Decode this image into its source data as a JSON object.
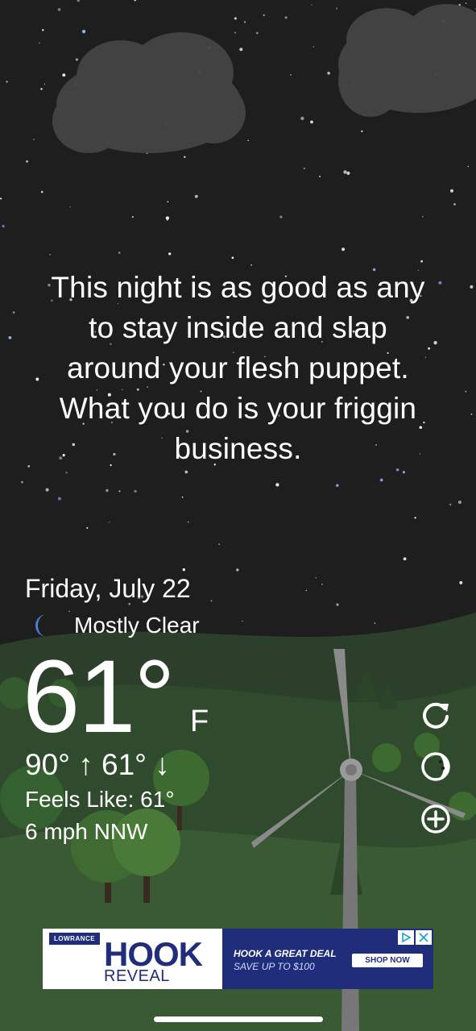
{
  "quote": {
    "lines": [
      "This night is as good as any",
      "to stay inside and slap",
      "around your flesh puppet.",
      "What you do is your friggin",
      "business."
    ]
  },
  "weather": {
    "date": "Friday, July 22",
    "condition": "Mostly Clear",
    "condition_icon": "moon-icon",
    "temperature": "61°",
    "unit": "F",
    "high_low": "90° ↑  61° ↓",
    "feels_like": "Feels Like: 61°",
    "wind": "6 mph NNW"
  },
  "actions": {
    "refresh": "refresh-icon",
    "moon_phase": "moon-phase-icon",
    "add": "add-icon"
  },
  "ad": {
    "brand": "LOWRANCE",
    "product_line1": "HOOK",
    "product_line2": "REVEAL",
    "headline": "HOOK A GREAT DEAL",
    "subline": "SAVE UP TO $100",
    "cta": "SHOP NOW"
  },
  "colors": {
    "sky": "#1e1e1f",
    "hills": "#2f4a2c",
    "ad_blue": "#1f2d7a",
    "moon": "#4a7fe0"
  }
}
